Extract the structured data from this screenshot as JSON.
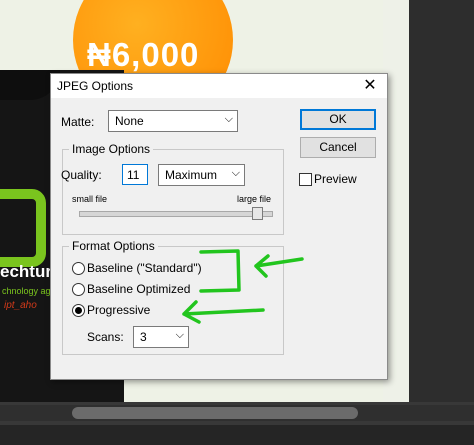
{
  "background": {
    "price": "₦6,000",
    "brand_name": "echtur",
    "brand_tagline": "chnology agency",
    "brand_signature": "ipt_aho"
  },
  "dialog": {
    "title": "JPEG Options",
    "matte_label": "Matte:",
    "matte_value": "None",
    "image_options": {
      "legend": "Image Options",
      "quality_label": "Quality:",
      "quality_value": "11",
      "quality_preset": "Maximum",
      "slider_min_label": "small file",
      "slider_max_label": "large file",
      "slider_level_fraction": 0.92
    },
    "format_options": {
      "legend": "Format Options",
      "options": [
        {
          "label": "Baseline (\"Standard\")",
          "selected": false
        },
        {
          "label": "Baseline Optimized",
          "selected": false
        },
        {
          "label": "Progressive",
          "selected": true
        }
      ],
      "scans_label": "Scans:",
      "scans_value": "3"
    },
    "buttons": {
      "ok": "OK",
      "cancel": "Cancel"
    },
    "preview_label": "Preview",
    "preview_checked": false
  },
  "colors": {
    "annotation": "#22c51e",
    "price_circle": "#ff9a10",
    "brand_green": "#7ac41e"
  },
  "icons": {
    "close": "close-icon",
    "dropdown": "chevron-down-icon"
  }
}
